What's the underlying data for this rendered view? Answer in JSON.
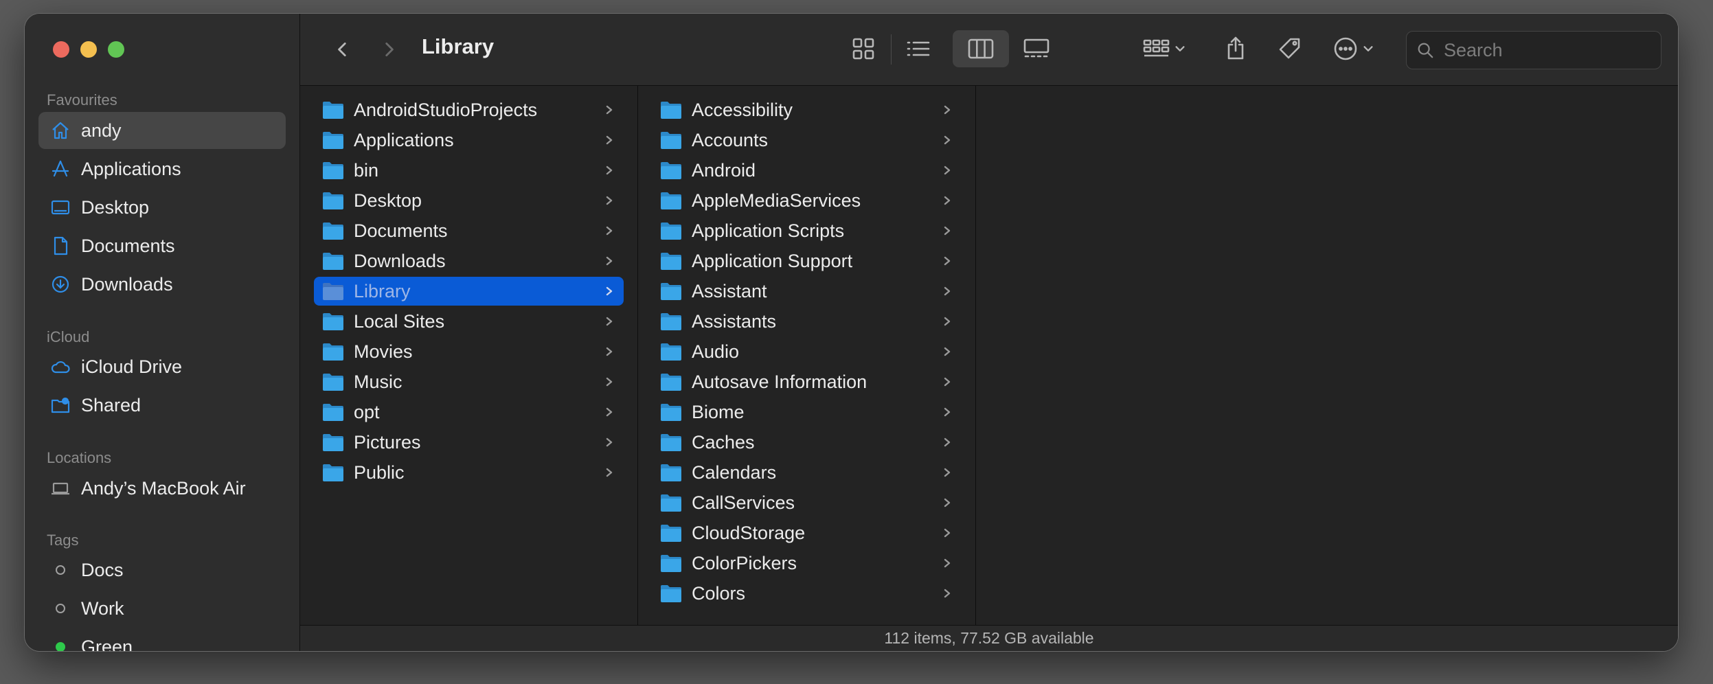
{
  "window": {
    "title": "Library"
  },
  "sidebar": {
    "favourites_header": "Favourites",
    "favourites": [
      {
        "label": "andy",
        "icon": "home-icon",
        "selected": true
      },
      {
        "label": "Applications",
        "icon": "applications-icon"
      },
      {
        "label": "Desktop",
        "icon": "desktop-icon"
      },
      {
        "label": "Documents",
        "icon": "document-icon"
      },
      {
        "label": "Downloads",
        "icon": "download-icon"
      }
    ],
    "icloud_header": "iCloud",
    "icloud": [
      {
        "label": "iCloud Drive",
        "icon": "cloud-icon"
      },
      {
        "label": "Shared",
        "icon": "shared-folder-icon"
      }
    ],
    "locations_header": "Locations",
    "locations": [
      {
        "label": "Andy’s MacBook Air",
        "icon": "laptop-icon"
      }
    ],
    "tags_header": "Tags",
    "tags": [
      {
        "label": "Docs",
        "color": ""
      },
      {
        "label": "Work",
        "color": ""
      },
      {
        "label": "Green",
        "color": "#2ec94b"
      }
    ]
  },
  "toolbar": {
    "title": "Library",
    "search_placeholder": "Search",
    "active_view": "columns"
  },
  "columns": {
    "home": [
      "AndroidStudioProjects",
      "Applications",
      "bin",
      "Desktop",
      "Documents",
      "Downloads",
      "Library",
      "Local Sites",
      "Movies",
      "Music",
      "opt",
      "Pictures",
      "Public"
    ],
    "home_selected": "Library",
    "library": [
      "Accessibility",
      "Accounts",
      "Android",
      "AppleMediaServices",
      "Application Scripts",
      "Application Support",
      "Assistant",
      "Assistants",
      "Audio",
      "Autosave Information",
      "Biome",
      "Caches",
      "Calendars",
      "CallServices",
      "CloudStorage",
      "ColorPickers",
      "Colors"
    ]
  },
  "status": {
    "text": "112 items, 77.52 GB available"
  },
  "colors": {
    "accent": "#0a5bd6",
    "folder": "#3aa6e8",
    "icon_blue": "#2f8ee8"
  }
}
